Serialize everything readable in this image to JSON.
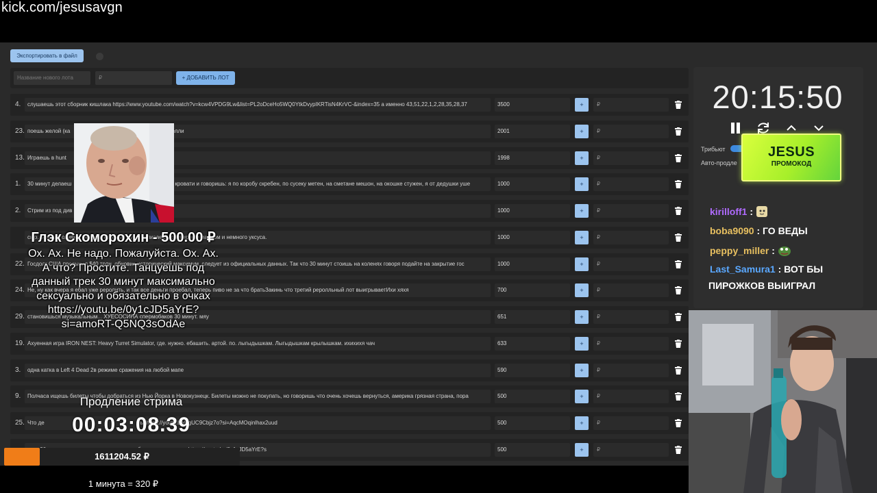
{
  "url": "kick.com/jesusavgn",
  "export_button": "Экспортировать в файл",
  "new_lot": {
    "name_placeholder": "Название нового лота",
    "amount_placeholder": "₽",
    "add_button": "+ ДОБАВИТЬ ЛОТ"
  },
  "lots": [
    {
      "num": "4.",
      "title": "слушаешь этот сборник кишлака https://www.youtube.com/watch?v=kcw4VPDG9Lw&list=PL2oDceHo5WQ0YtkDvypIKRTisN4KrVC-&index=35 а именно 43,51,22,1,2,28,35,28,37",
      "amount": "3500",
      "rub": "₽"
    },
    {
      "num": "23.",
      "title": "поешь желой (ка",
      "title2": "ччелли",
      "amount": "2001",
      "rub": "₽"
    },
    {
      "num": "13.",
      "title": "Играешь в hunt",
      "amount": "1998",
      "rub": "₽"
    },
    {
      "num": "1.",
      "title": "30 минут делаеш",
      "title2": "на кровати и говоришь: я по коробу скребен, по сусеку метен, на сметане мешон, на окошке стужен, я от дедушки уше",
      "amount": "1000",
      "rub": "₽"
    },
    {
      "num": "2.",
      "title": "Стрим из под див",
      "amount": "1000",
      "rub": "₽"
    },
    {
      "num": "",
      "title": "сыр, режешь оливки, режешь красный лук и поливаешь оливковым маслом и немного уксуса.",
      "amount": "1000",
      "rub": "₽"
    },
    {
      "num": "22.",
      "title": "Госдолг США превысил $40 трлн, обновив исторический максимум, следует из официальных данных. Так что 30 минут стоишь на коленях говоря подайте на закрытие гос",
      "amount": "1000",
      "rub": "₽"
    },
    {
      "num": "24.",
      "title": "Не, ну как вчера я ебал уже реролить, и так все деньги проебал, теперь пиво не за что братьЗакинь что третий реролльный лот выигрываетИхи хяхя",
      "amount": "700",
      "rub": "₽"
    },
    {
      "num": "29.",
      "title": "становишься музыкальным... ХУЕСОСИНА спермобаков 30 минут. мяу",
      "amount": "651",
      "rub": "₽"
    },
    {
      "num": "19.",
      "title": "Ахуенная игра IRON NEST: Heavy Turret Simulator, где. нужно. ебашить. артой. по. лыгыдышкам. Лыгыдышкам крылышкам. ихихихя чач",
      "amount": "633",
      "rub": "₽"
    },
    {
      "num": "3.",
      "title": "одна катка в Left 4 Dead 2в режиме сражения на любой мапе",
      "amount": "590",
      "rub": "₽"
    },
    {
      "num": "9.",
      "title": "Полчаса ищешь билеты чтобы добраться из Нью Йорка в Новокузнецк. Билеты можно не покупать, но говоришь что очень хочешь вернуться, америка грязная страна, пора",
      "amount": "500",
      "rub": "₽"
    },
    {
      "num": "25.",
      "title": "Что де",
      "title2": "ь. https://youtu.be/6gUC9Cbjz7o?si=AqcMOqinlhax2uud",
      "amount": "500",
      "rub": "₽"
    },
    {
      "num": "",
      "title": "трек 30 минут максимально сексуально и обязательно в очках https://youtu.be/0y1cJD5aYrE?s",
      "amount": "500",
      "rub": "₽"
    }
  ],
  "timer": {
    "clock": "20:15:50",
    "tribute_label": "Трибьют",
    "auto_label": "Авто-продле"
  },
  "promo": {
    "big": "JESUS",
    "small": "ПРОМОКОД"
  },
  "chat": [
    {
      "user": "kirilloff1",
      "sep": " :",
      "text": "",
      "color": "#b06bff"
    },
    {
      "user": "boba9090",
      "sep": " :",
      "text": " ГО ВЕДЫ",
      "color": "#e8c060"
    },
    {
      "user": "peppy_miller",
      "sep": " :",
      "text": "",
      "color": "#e8c060"
    },
    {
      "user": "Last_Samura1",
      "sep": " :",
      "text": " ВОТ БЫ",
      "color": "#5aa8ff"
    }
  ],
  "chat_wrap": "ПИРОЖКОВ ВЫИГРАЛ",
  "donation": {
    "title": "Глэк Скоморохин - 500.00 ₽",
    "lines": [
      "Ох. Ах. Не надо. Пожалуйста. Ох. Ах.",
      "А что? Простите. Танцуешь под",
      "данный трек 30 минут максимально",
      "сексуально и обязательно в очках",
      "https://youtu.be/0y1cJD5aYrE?",
      "si=amoRT-Q5NQ3sOdAe"
    ]
  },
  "extension": {
    "label": "Продление стрима",
    "time": "00:03:08.39"
  },
  "total": {
    "value": "1611204.52 ₽",
    "progress_fraction": 0.15
  },
  "rate": "1 минута = 320 ₽",
  "colors": {
    "accent": "#9cc4ee",
    "progress": "#f07d18",
    "promo": "#b6f22c"
  }
}
